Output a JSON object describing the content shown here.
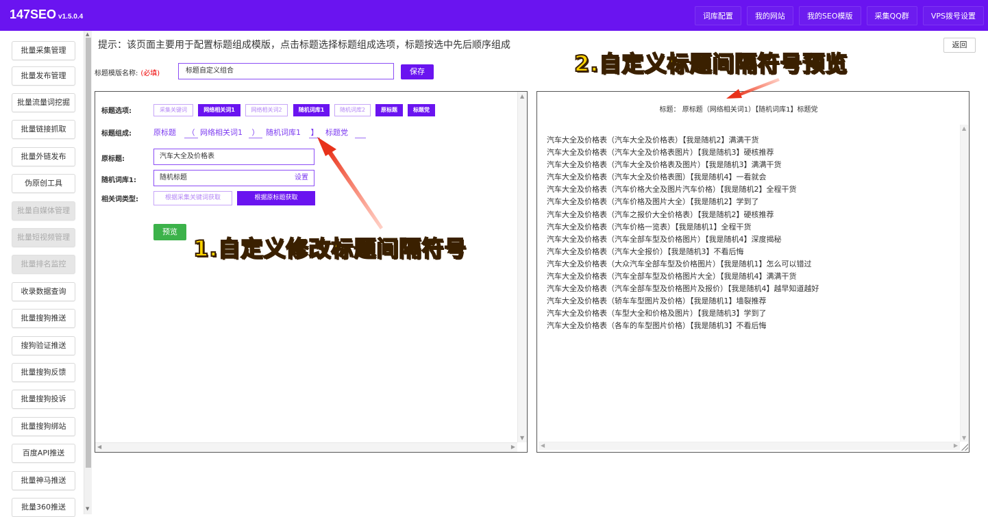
{
  "app": {
    "name": "147SEO",
    "version": "v1.5.0.4"
  },
  "topnav": [
    "词库配置",
    "我的网站",
    "我的SEO模版",
    "采集QQ群",
    "VPS拨号设置"
  ],
  "sidebar": [
    {
      "label": "批量采集管理",
      "disabled": false
    },
    {
      "label": "批量发布管理",
      "disabled": false
    },
    {
      "label": "批量流量词挖掘",
      "disabled": false
    },
    {
      "label": "批量链接抓取",
      "disabled": false
    },
    {
      "label": "批量外链发布",
      "disabled": false
    },
    {
      "label": "伪原创工具",
      "disabled": false
    },
    {
      "label": "批量自媒体管理",
      "disabled": true
    },
    {
      "label": "批量短视频管理",
      "disabled": true
    },
    {
      "label": "批量排名监控",
      "disabled": true
    },
    {
      "label": "收录数据查询",
      "disabled": false
    },
    {
      "label": "批量搜狗推送",
      "disabled": false
    },
    {
      "label": "搜狗验证推送",
      "disabled": false
    },
    {
      "label": "批量搜狗反馈",
      "disabled": false
    },
    {
      "label": "批量搜狗投诉",
      "disabled": false
    },
    {
      "label": "批量搜狗绑站",
      "disabled": false
    },
    {
      "label": "百度API推送",
      "disabled": false
    },
    {
      "label": "批量神马推送",
      "disabled": false
    },
    {
      "label": "批量360推送",
      "disabled": false
    }
  ],
  "tip": "提示：该页面主要用于配置标题组成模版，点击标题选择标题组成选项，标题按选中先后顺序组成",
  "back_label": "返回",
  "template_name": {
    "label": "标题模版名称:",
    "required": "(必填)",
    "value": "标题自定义组合",
    "save_label": "保存"
  },
  "title_options": {
    "label": "标题选项:",
    "tags": [
      {
        "text": "采集关键词",
        "active": false
      },
      {
        "text": "网络相关词1",
        "active": true
      },
      {
        "text": "网络相关词2",
        "active": false
      },
      {
        "text": "随机词库1",
        "active": true
      },
      {
        "text": "随机词库2",
        "active": false
      },
      {
        "text": "原标题",
        "active": true
      },
      {
        "text": "标题党",
        "active": true
      }
    ]
  },
  "composition": {
    "label": "标题组成:",
    "parts": [
      "原标题",
      "（",
      "网络相关词1",
      "）",
      "随机词库1",
      "】",
      "标题党"
    ]
  },
  "original_title": {
    "label": "原标题:",
    "value": "汽车大全及价格表"
  },
  "random_lib": {
    "label": "随机词库1:",
    "value": "随机标题",
    "setting": "设置"
  },
  "related_type": {
    "label": "相关词类型:",
    "option_a": "根据采集关键词获取",
    "option_b": "根据原标题获取"
  },
  "preview_label": "预览",
  "preview_title": "标题： 原标题（网络相关词1）【随机词库1】标题党",
  "results": [
    "汽车大全及价格表（汽车大全及价格表）【我是随机2】满满干货",
    "汽车大全及价格表（汽车大全及价格表图片）【我是随机3】硬核推荐",
    "汽车大全及价格表（汽车大全及价格表及图片）【我是随机3】满满干货",
    "汽车大全及价格表（汽车大全及价格表图）【我是随机4】一看就会",
    "汽车大全及价格表（汽车价格大全及图片汽车价格）【我是随机2】全程干货",
    "汽车大全及价格表（汽车价格及图片大全）【我是随机2】学到了",
    "汽车大全及价格表（汽车之报价大全价格表）【我是随机2】硬核推荐",
    "汽车大全及价格表（汽车价格一览表）【我是随机1】全程干货",
    "汽车大全及价格表（汽车全部车型及价格图片）【我是随机4】深度揭秘",
    "汽车大全及价格表（汽车大全报价）【我是随机3】不看后悔",
    "汽车大全及价格表（大众汽车全部车型及价格图片）【我是随机1】怎么可以错过",
    "汽车大全及价格表（汽车全部车型及价格图片大全）【我是随机4】满满干货",
    "汽车大全及价格表（汽车全部车型及价格图片及报价）【我是随机4】越早知道越好",
    "汽车大全及价格表（轿车车型图片及价格）【我是随机1】墙裂推荐",
    "汽车大全及价格表（车型大全和价格及图片）【我是随机3】学到了",
    "汽车大全及价格表（各车的车型图片价格）【我是随机3】不看后悔"
  ],
  "annotations": {
    "callout_1": "1.自定义修改标题间隔符号",
    "callout_2": "2.自定义标题间隔符号预览",
    "color": "#ffd400"
  }
}
